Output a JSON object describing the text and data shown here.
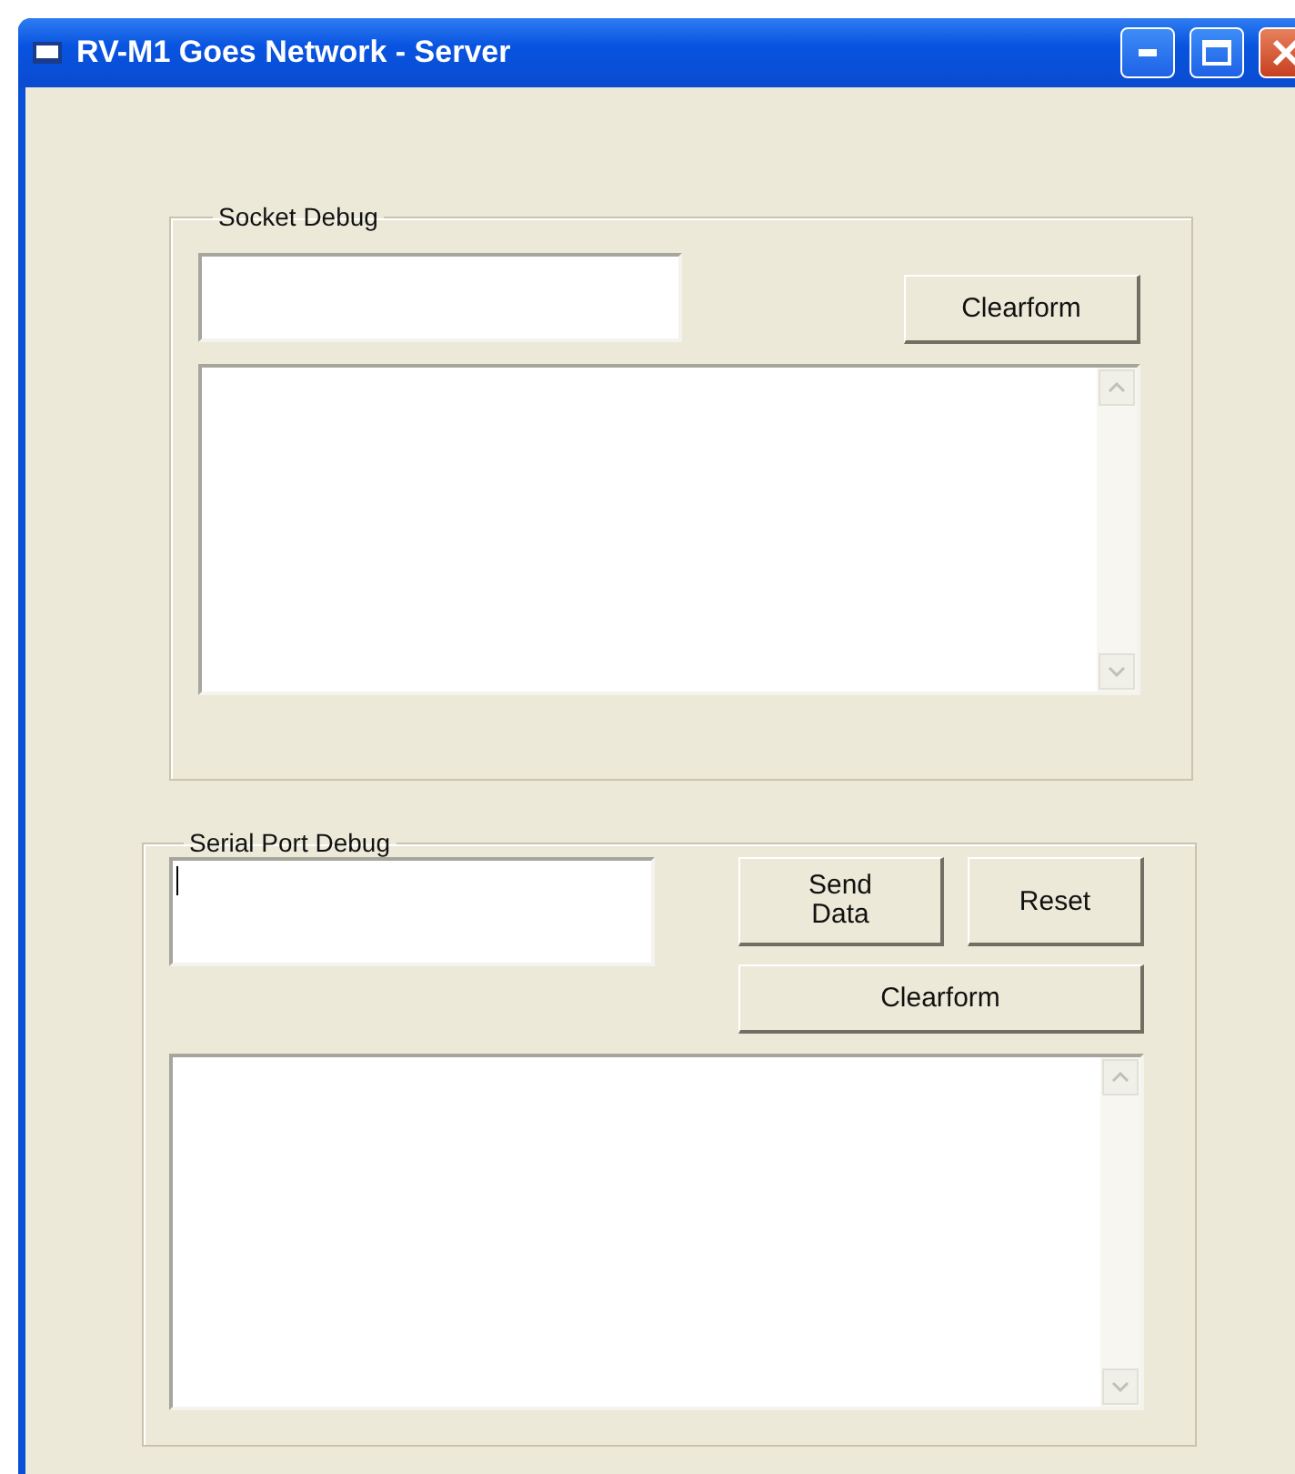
{
  "window": {
    "title": "RV-M1 Goes Network - Server"
  },
  "socket_debug": {
    "title": "Socket Debug",
    "clear_button": "Clearform"
  },
  "serial_debug": {
    "title": "Serial Port Debug",
    "input": {
      "focused": true
    },
    "send_button": "Send Data",
    "reset_button": "Reset",
    "clear_button": "Clearform"
  }
}
